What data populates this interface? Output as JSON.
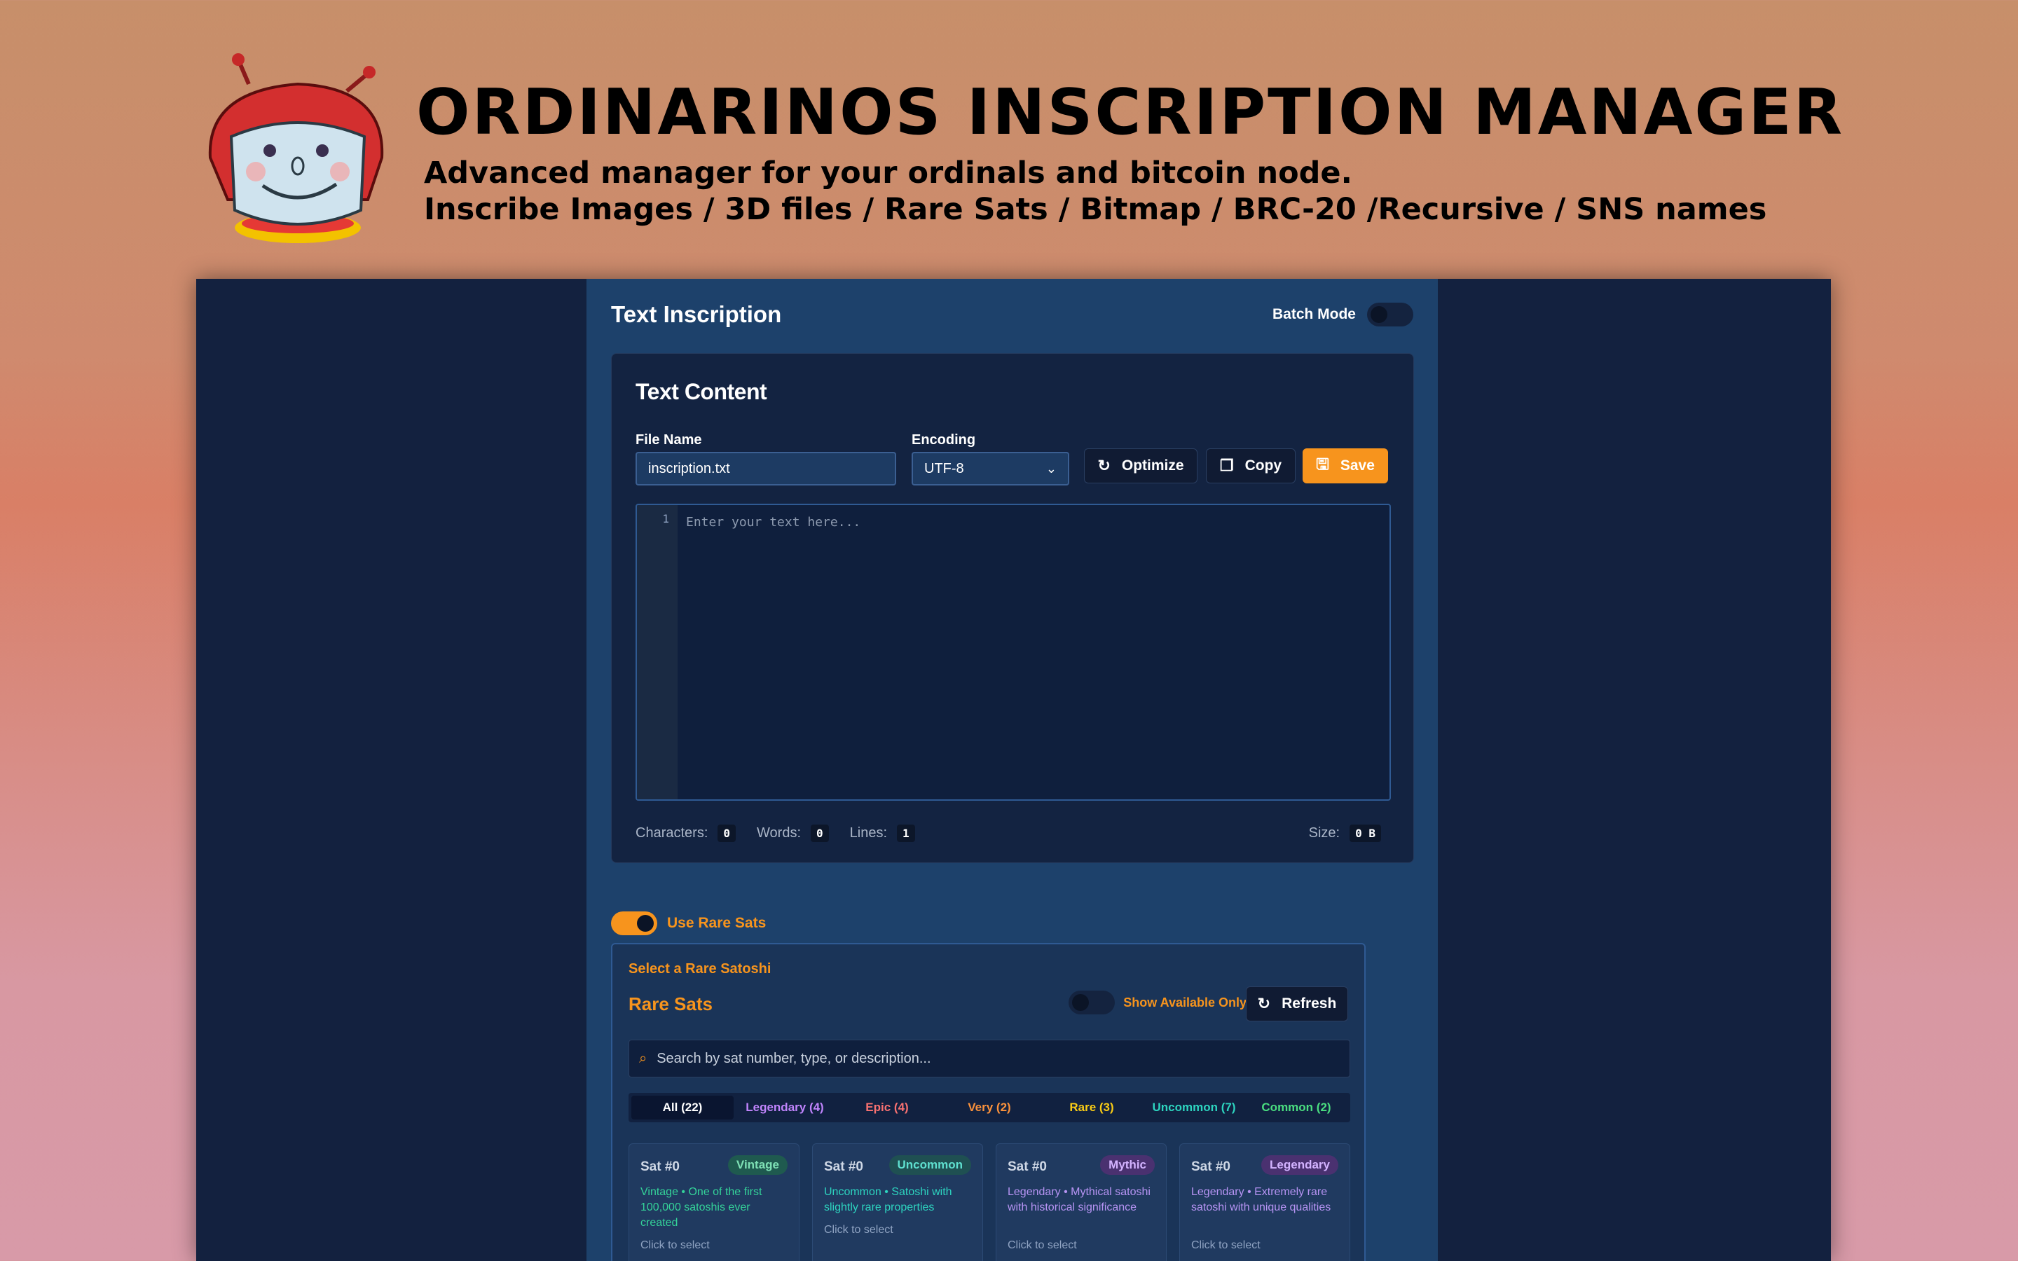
{
  "hero": {
    "title": "ORDINARINOS INSCRIPTION MANAGER",
    "subtitle_1": "Advanced manager for your ordinals and bitcoin node.",
    "subtitle_2": "Inscribe Images / 3D files / Rare Sats / Bitmap / BRC-20 /Recursive / SNS names"
  },
  "panel": {
    "title": "Text Inscription",
    "batch_label": "Batch Mode",
    "batch_on": false
  },
  "text_content": {
    "title": "Text Content",
    "file_name_label": "File Name",
    "file_name_value": "inscription.txt",
    "encoding_label": "Encoding",
    "encoding_value": "UTF-8",
    "optimize_label": "Optimize",
    "copy_label": "Copy",
    "save_label": "Save",
    "line_number": "1",
    "editor_placeholder": "Enter your text here...",
    "stats": {
      "characters_label": "Characters:",
      "characters": "0",
      "words_label": "Words:",
      "words": "0",
      "lines_label": "Lines:",
      "lines": "1",
      "size_label": "Size:",
      "size": "0 B"
    }
  },
  "rare_sats": {
    "use_label": "Use Rare Sats",
    "use_on": true,
    "select_label": "Select a Rare Satoshi",
    "title": "Rare Sats",
    "available_only_label": "Show Available Only",
    "available_only_on": false,
    "refresh_label": "Refresh",
    "search_placeholder": "Search by sat number, type, or description...",
    "filters": [
      {
        "label": "All (22)",
        "color": "#ffffff",
        "active": true
      },
      {
        "label": "Legendary (4)",
        "color": "#c084fc",
        "active": false
      },
      {
        "label": "Epic (4)",
        "color": "#f87171",
        "active": false
      },
      {
        "label": "Very (2)",
        "color": "#fb923c",
        "active": false
      },
      {
        "label": "Rare (3)",
        "color": "#facc15",
        "active": false
      },
      {
        "label": "Uncommon (7)",
        "color": "#2dd4bf",
        "active": false
      },
      {
        "label": "Common (2)",
        "color": "#4ade80",
        "active": false
      }
    ],
    "sats": [
      {
        "name": "Sat #0",
        "tag": "Vintage",
        "tag_bg": "#1f5a4f",
        "tag_color": "#7ee0b5",
        "desc": "Vintage • One of the first 100,000 satoshis ever created",
        "desc_color": "#34d399",
        "click": "Click to select"
      },
      {
        "name": "Sat #0",
        "tag": "Uncommon",
        "tag_bg": "#1f5052",
        "tag_color": "#5fe0d0",
        "desc": "Uncommon • Satoshi with slightly rare properties",
        "desc_color": "#2dd4bf",
        "click": "Click to select"
      },
      {
        "name": "Sat #0",
        "tag": "Mythic",
        "tag_bg": "#4a3170",
        "tag_color": "#d3b3ff",
        "desc": "Legendary • Mythical satoshi with historical significance",
        "desc_color": "#b794f4",
        "click": "Click to select"
      },
      {
        "name": "Sat #0",
        "tag": "Legendary",
        "tag_bg": "#4a3170",
        "tag_color": "#d3b3ff",
        "desc": "Legendary • Extremely rare satoshi with unique qualities",
        "desc_color": "#b794f4",
        "click": "Click to select"
      }
    ]
  }
}
